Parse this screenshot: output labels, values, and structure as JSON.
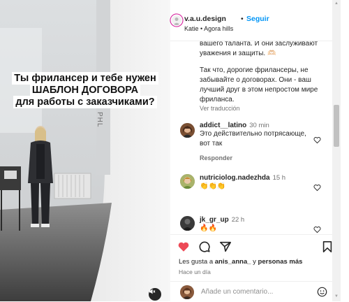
{
  "video": {
    "caption_lines": [
      "Ты фрилансер и тебе нужен",
      "ШАБЛОН ДОГОВОРА",
      "для работы с заказчиками?"
    ],
    "wall_text": "PHL",
    "sound_icon": "speaker-muted-icon"
  },
  "header": {
    "username": "v.a.u.design",
    "separator": "•",
    "follow_label": "Seguir",
    "subtitle": "Katie • Agora hills"
  },
  "caption": {
    "paragraph1": "вашего таланта. И они заслуживают уважения и защиты. 🫶🏻",
    "paragraph2": "Так что, дорогие фрилансеры, не забывайте о договорах. Они - ваш лучший друг в этом непростом мире фриланса.",
    "see_translation": "Ver traducción"
  },
  "comments": [
    {
      "username": "addict__latino",
      "time": "30 min",
      "text": "Это действительно потрясающе, вот так",
      "reply_label": "Responder"
    },
    {
      "username": "nutriciolog.nadezhda",
      "time": "15 h",
      "text": "👏👏👏",
      "reply_label": null
    },
    {
      "username": "jk_gr_up",
      "time": "22 h",
      "text": "🔥🔥",
      "reply_label": null
    }
  ],
  "actions": {
    "like_icon": "heart-filled-icon",
    "comment_icon": "comment-icon",
    "share_icon": "send-icon",
    "save_icon": "bookmark-icon",
    "likes_prefix": "Les gusta a ",
    "likes_user": "anis_anna_",
    "likes_suffix": " y ",
    "likes_more": "personas más",
    "posted": "Hace un día"
  },
  "add_comment": {
    "placeholder": "Añade un comentario...",
    "emoji_icon": "smiley-icon"
  },
  "colors": {
    "accent": "#0095f6",
    "like": "#ed4956",
    "muted": "#737373"
  }
}
